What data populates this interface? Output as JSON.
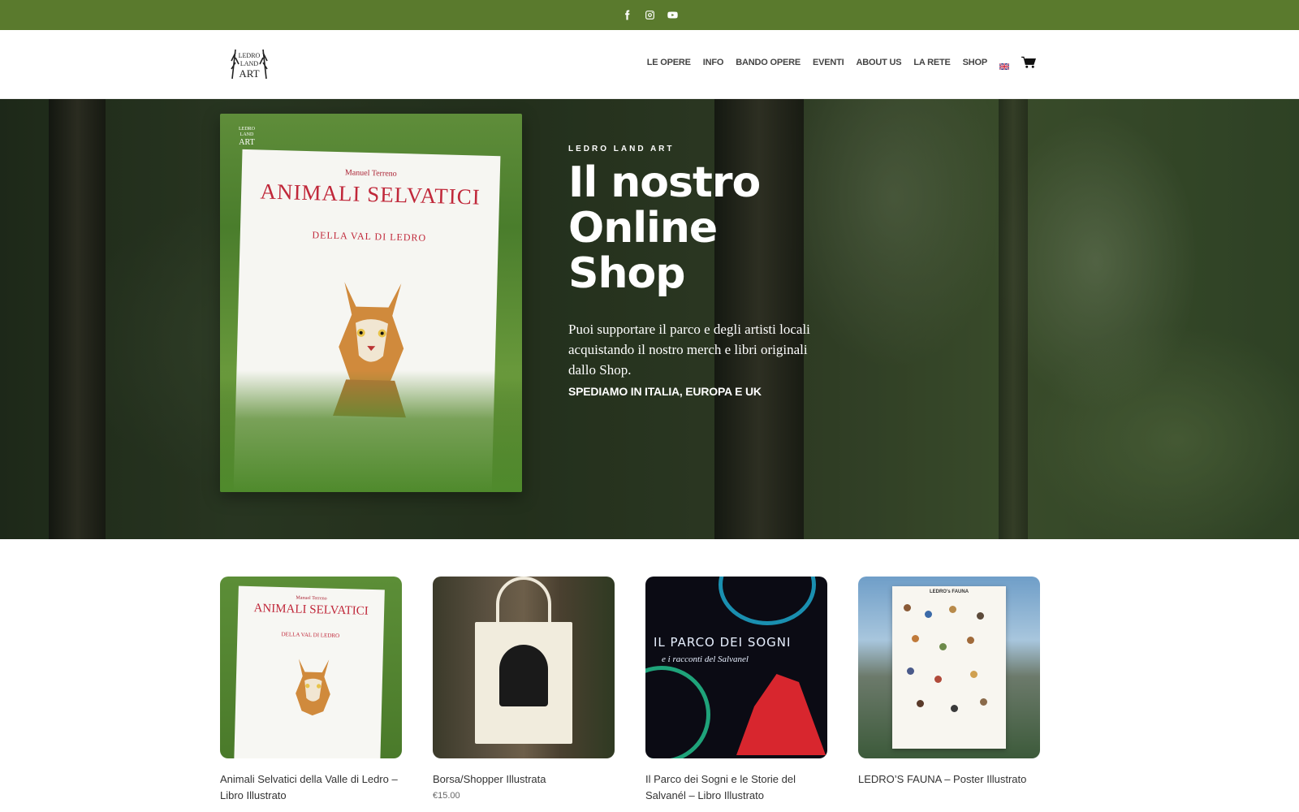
{
  "topbar": {
    "social": [
      {
        "name": "facebook-icon"
      },
      {
        "name": "instagram-icon"
      },
      {
        "name": "youtube-icon"
      }
    ]
  },
  "header": {
    "logo_text": "LEDRO LAND ART",
    "nav": [
      {
        "label": "LE OPERE"
      },
      {
        "label": "INFO"
      },
      {
        "label": "BANDO OPERE"
      },
      {
        "label": "EVENTI"
      },
      {
        "label": "ABOUT US"
      },
      {
        "label": "LA RETE"
      },
      {
        "label": "SHOP"
      }
    ]
  },
  "hero": {
    "kicker": "LEDRO LAND ART",
    "headline": "Il nostro Online Shop",
    "lead": "Puoi supportare il parco e degli artisti locali acquistando il nostro merch e libri originali dallo Shop.",
    "shipping": "SPEDIAMO IN ITALIA, EUROPA E UK",
    "book": {
      "author": "Manuel Terreno",
      "title": "ANIMALI SELVATICI",
      "subtitle": "DELLA VAL DI LEDRO"
    }
  },
  "products": [
    {
      "name": "Animali Selvatici della Valle di Ledro – Libro Illustrato",
      "price": ""
    },
    {
      "name": "Borsa/Shopper Illustrata",
      "price": "€15.00"
    },
    {
      "name": "Il Parco dei Sogni e le Storie del Salvanél – Libro Illustrato",
      "price": "",
      "cover_title": "IL PARCO DEI SOGNI",
      "cover_subtitle": "e i racconti del Salvanel"
    },
    {
      "name": "LEDRO’S FAUNA – Poster Illustrato",
      "price": "",
      "poster_title": "LEDRO's FAUNA"
    }
  ],
  "colors": {
    "topbar": "#5a7a2d",
    "nav_text": "#444444",
    "hero_text": "#ffffff"
  }
}
